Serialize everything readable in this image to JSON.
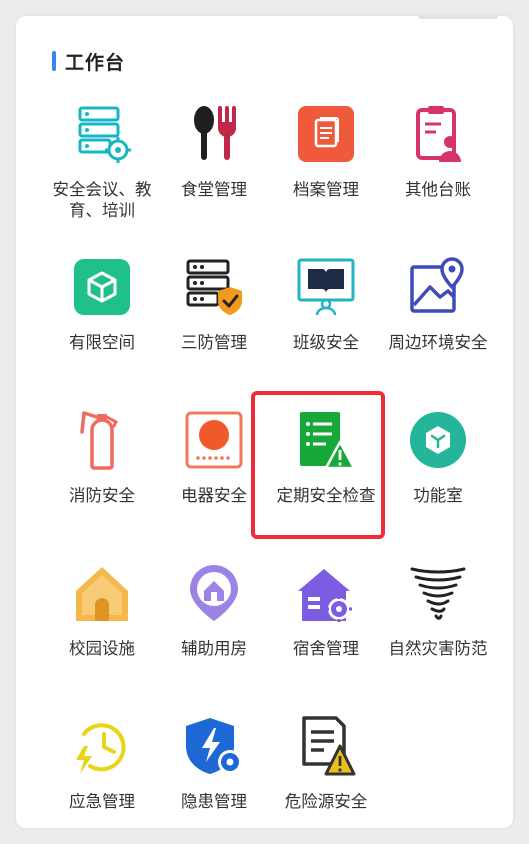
{
  "header": {
    "title": "工作台",
    "accent_color": "#3b82f6"
  },
  "tiles": [
    {
      "label": "安全会议、教育、培训",
      "icon": "database-gear-icon"
    },
    {
      "label": "食堂管理",
      "icon": "spoon-fork-icon"
    },
    {
      "label": "档案管理",
      "icon": "archive-doc-icon"
    },
    {
      "label": "其他台账",
      "icon": "clipboard-user-icon"
    },
    {
      "label": "有限空间",
      "icon": "cube-icon"
    },
    {
      "label": "三防管理",
      "icon": "server-shield-icon"
    },
    {
      "label": "班级安全",
      "icon": "book-reader-icon"
    },
    {
      "label": "周边环境安全",
      "icon": "map-pin-icon"
    },
    {
      "label": "消防安全",
      "icon": "fire-extinguisher-icon"
    },
    {
      "label": "电器安全",
      "icon": "appliance-icon"
    },
    {
      "label": "定期安全检查",
      "icon": "checklist-warning-icon"
    },
    {
      "label": "功能室",
      "icon": "hex-cube-icon"
    },
    {
      "label": "校园设施",
      "icon": "house-icon"
    },
    {
      "label": "辅助用房",
      "icon": "house-pin-icon"
    },
    {
      "label": "宿舍管理",
      "icon": "house-gear-icon"
    },
    {
      "label": "自然灾害防范",
      "icon": "tornado-icon"
    },
    {
      "label": "应急管理",
      "icon": "clock-bolt-icon"
    },
    {
      "label": "隐患管理",
      "icon": "shield-bolt-gear-icon"
    },
    {
      "label": "危险源安全",
      "icon": "document-warning-icon"
    }
  ],
  "highlighted_tile": "定期安全检查",
  "colors": {
    "highlight": "#ef2b36"
  }
}
